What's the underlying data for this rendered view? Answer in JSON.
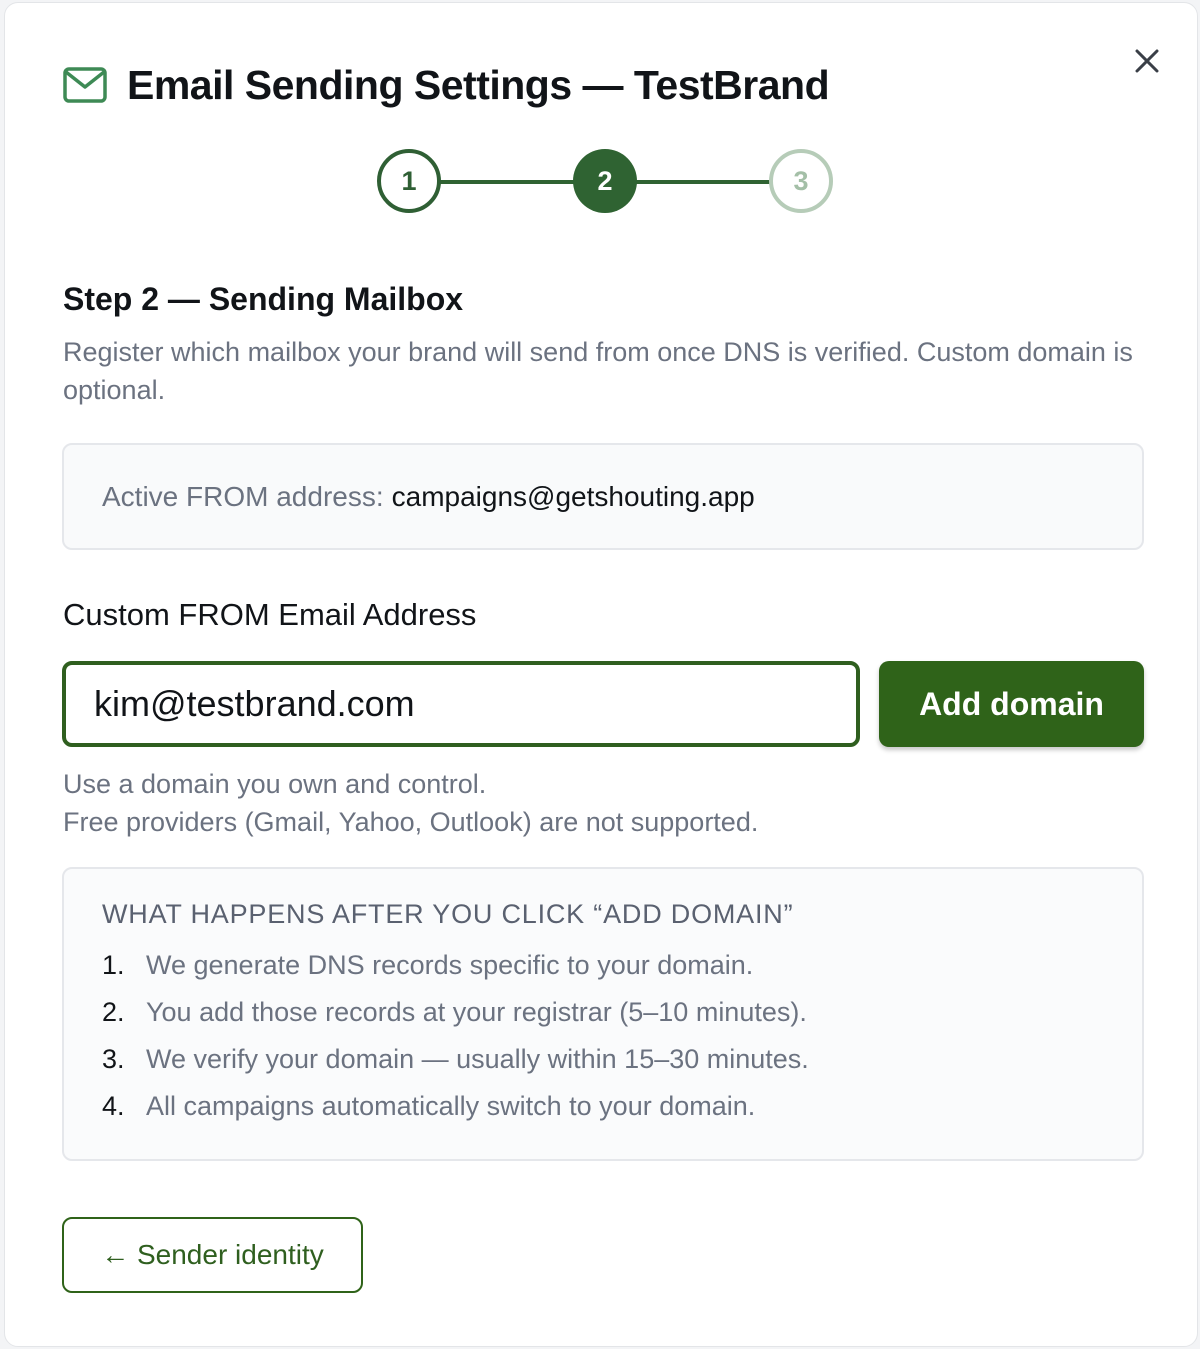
{
  "modal": {
    "title": "Email Sending Settings — TestBrand",
    "close_icon": "close-icon",
    "title_icon": "mail-icon"
  },
  "stepper": {
    "steps": [
      {
        "label": "1",
        "state": "done"
      },
      {
        "label": "2",
        "state": "current"
      },
      {
        "label": "3",
        "state": "upcoming"
      }
    ]
  },
  "step": {
    "heading": "Step 2 — Sending Mailbox",
    "description": "Register which mailbox your brand will send from once DNS is verified. Custom domain is optional."
  },
  "active_from": {
    "label": "Active FROM address:",
    "value": "campaigns@getshouting.app"
  },
  "custom_from": {
    "label": "Custom FROM Email Address",
    "value": "kim@testbrand.com",
    "button_label": "Add domain",
    "hint_line1": "Use a domain you own and control.",
    "hint_line2": "Free providers (Gmail, Yahoo, Outlook) are not supported."
  },
  "info": {
    "title": "WHAT HAPPENS AFTER YOU CLICK “ADD DOMAIN”",
    "items": [
      {
        "num": "1.",
        "text": "We generate DNS records specific to your domain."
      },
      {
        "num": "2.",
        "text": "You add those records at your registrar (5–10 minutes)."
      },
      {
        "num": "3.",
        "text": "We verify your domain — usually within 15–30 minutes."
      },
      {
        "num": "4.",
        "text": "All campaigns automatically switch to your domain."
      }
    ]
  },
  "footer": {
    "back_label": "← Sender identity"
  },
  "colors": {
    "primary": "#2f6319",
    "step_active": "#2f6332",
    "step_upcoming": "#b6ccb8",
    "mail_icon": "#3e8a55"
  }
}
